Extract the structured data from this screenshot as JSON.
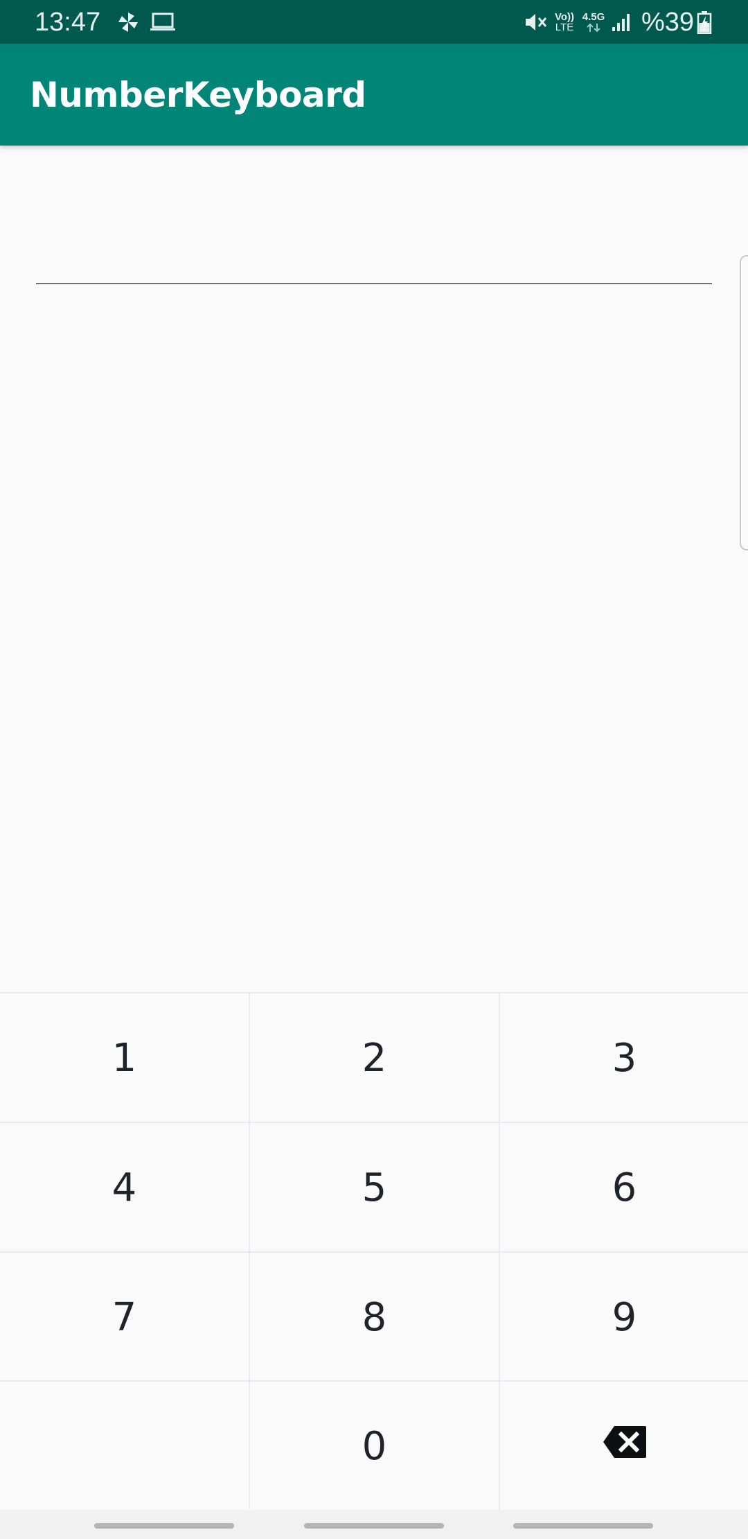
{
  "status_bar": {
    "time": "13:47",
    "battery_text": "%39",
    "icons": [
      "pinwheel-icon",
      "laptop-icon",
      "mute-icon",
      "volte-icon",
      "data-4.5g-icon",
      "signal-icon",
      "battery-charging-icon"
    ],
    "volte_top": "Vo))",
    "volte_bottom": "LTE",
    "data_label": "4.5G",
    "background_color": "#00594e"
  },
  "app_bar": {
    "title": "NumberKeyboard",
    "background_color": "#008577"
  },
  "input": {
    "value": "",
    "placeholder": ""
  },
  "keyboard": {
    "keys": [
      "1",
      "2",
      "3",
      "4",
      "5",
      "6",
      "7",
      "8",
      "9",
      "",
      "0",
      "backspace"
    ],
    "key_text_color": "#1f232a",
    "divider_color": "#e8eaed"
  }
}
